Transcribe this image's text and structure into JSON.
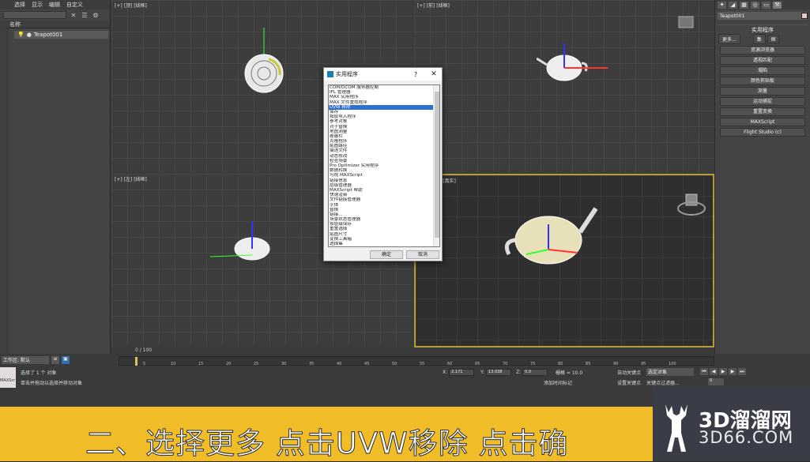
{
  "explorer": {
    "menu": [
      "选择",
      "显示",
      "编辑",
      "自定义"
    ],
    "column_header": "名称",
    "object_name": "Teapot001"
  },
  "viewports": {
    "top": "[+] [顶] [线框]",
    "front": "[+] [前] [线框]",
    "left": "[+] [左] [线框]",
    "persp": "[+] [透视] [真实]"
  },
  "time_meter": "0 / 100",
  "command_panel": {
    "object_name": "Teapot001",
    "rollout_title": "实用程序",
    "more_button": "更多...",
    "set_button": "集",
    "utilities": [
      "资源浏览器",
      "透视匹配",
      "塌陷",
      "颜色剪贴板",
      "测量",
      "运动捕捉",
      "重置变换",
      "MAXScript",
      "Flight Studio (c)"
    ]
  },
  "bottom": {
    "work_area_label": "工作区: 默认",
    "timeline_ticks": [
      "0",
      "5",
      "10",
      "15",
      "20",
      "25",
      "30",
      "35",
      "40",
      "45",
      "50",
      "55",
      "60",
      "65",
      "70",
      "75",
      "80",
      "85",
      "90",
      "95",
      "100"
    ],
    "status_selected": "选择了 1 个 对象",
    "status_hint": "单击并拖动以选择并移动对象",
    "maxscript_label": "MAXScr",
    "x_label": "X:",
    "x_value": "2.171",
    "y_label": "Y:",
    "y_value": "13.038",
    "z_label": "Z:",
    "z_value": "0.0",
    "grid_text": "栅格 = 10.0",
    "auto_key": "自动关键点",
    "selected_object": "选定对象",
    "set_key": "设置关键点",
    "key_filter": "关键点过滤器...",
    "add_time_tag": "添加时间标记",
    "frame_value": "0"
  },
  "dialog": {
    "title": "实用程序",
    "help": "?",
    "close": "✕",
    "items": [
      "COM/DCOM 服务器控制",
      "IFL 管理器",
      "MAX 实用程序",
      "MAX 文件重找程序",
      "UVW 移除",
      "保存",
      "按层导入程序",
      "参考对象",
      "对于替换",
      "地图测量",
      "卷展栏",
      "克隆程序",
      "贴图路径",
      "描述文件",
      "动态修改",
      "检查场景",
      "Pro Optimizer 实用程序",
      "数据转换",
      "可视 MAXScript",
      "链接信息",
      "层级管理器",
      "MAXScript 帮助",
      "快速渲染",
      "文件链接管理器",
      "字体",
      "替换",
      "链接...",
      "场景状态管理器",
      "按层级保存",
      "重置选择",
      "贴图尺寸",
      "变换工具箱",
      "选择集"
    ],
    "selected_index": 4,
    "ok": "确定",
    "cancel": "取消"
  },
  "caption": "二、选择更多   点击UVW移除   点击确",
  "watermark": {
    "title": "3D溜溜网",
    "url": "3D66.COM"
  }
}
